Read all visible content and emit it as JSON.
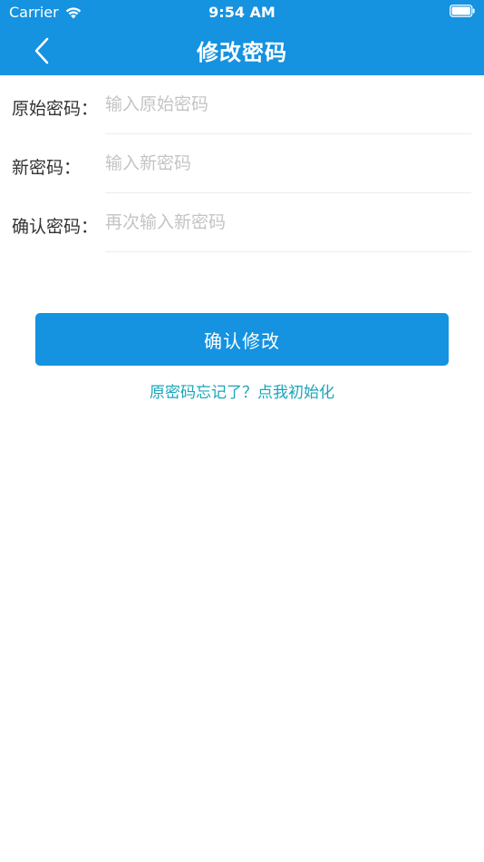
{
  "status_bar": {
    "carrier": "Carrier",
    "time": "9:54 AM"
  },
  "nav": {
    "title": "修改密码"
  },
  "form": {
    "fields": [
      {
        "label": "原始密码：",
        "placeholder": "输入原始密码",
        "value": ""
      },
      {
        "label": "新密码：",
        "placeholder": "输入新密码",
        "value": ""
      },
      {
        "label": "确认密码：",
        "placeholder": "再次输入新密码",
        "value": ""
      }
    ]
  },
  "actions": {
    "confirm_label": "确认修改",
    "forgot_label": "原密码忘记了？点我初始化"
  },
  "colors": {
    "primary": "#1592e0",
    "link": "#1aa5b8",
    "placeholder": "#c4c4c4"
  }
}
